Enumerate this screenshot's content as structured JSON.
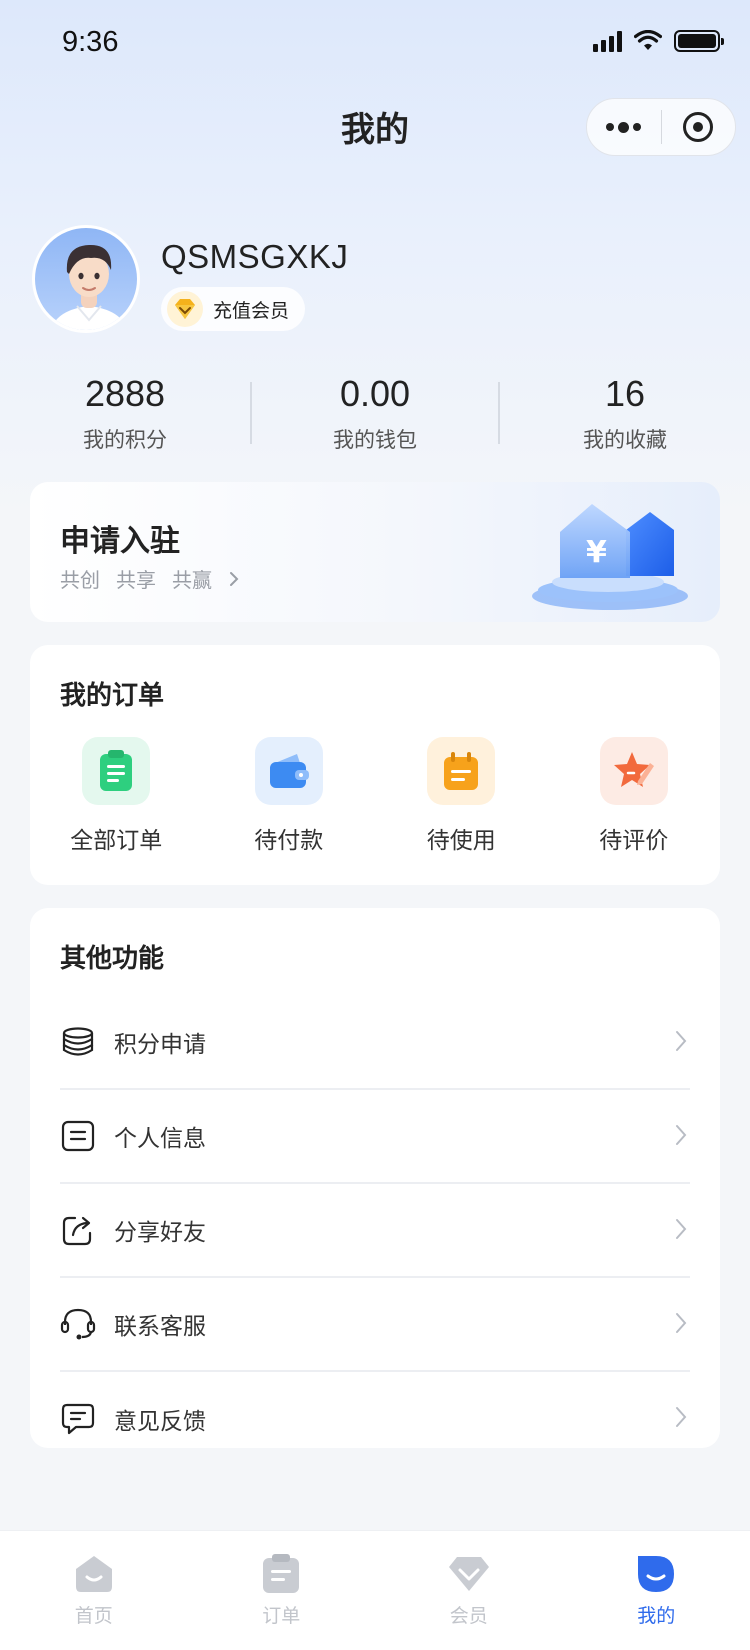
{
  "status_bar": {
    "time": "9:36"
  },
  "nav": {
    "title": "我的"
  },
  "profile": {
    "username": "QSMSGXKJ",
    "member_label": "充值会员"
  },
  "stats": [
    {
      "value": "2888",
      "label": "我的积分"
    },
    {
      "value": "0.00",
      "label": "我的钱包"
    },
    {
      "value": "16",
      "label": "我的收藏"
    }
  ],
  "apply": {
    "title": "申请入驻",
    "tags": [
      "共创",
      "共享",
      "共赢"
    ]
  },
  "orders": {
    "title": "我的订单",
    "items": [
      {
        "label": "全部订单",
        "icon": "clipboard-icon",
        "color": "#2ecf7f"
      },
      {
        "label": "待付款",
        "icon": "wallet-icon",
        "color": "#3d8bf2"
      },
      {
        "label": "待使用",
        "icon": "calendar-icon",
        "color": "#f7a21b"
      },
      {
        "label": "待评价",
        "icon": "star-pen-icon",
        "color": "#f26a3d"
      }
    ]
  },
  "functions": {
    "title": "其他功能",
    "items": [
      {
        "label": "积分申请",
        "icon": "coins-stack-icon"
      },
      {
        "label": "个人信息",
        "icon": "profile-card-icon"
      },
      {
        "label": "分享好友",
        "icon": "share-icon"
      },
      {
        "label": "联系客服",
        "icon": "headset-icon"
      },
      {
        "label": "意见反馈",
        "icon": "feedback-icon"
      }
    ]
  },
  "tabbar": {
    "items": [
      {
        "label": "首页",
        "icon": "home-icon",
        "active": false
      },
      {
        "label": "订单",
        "icon": "order-icon",
        "active": false
      },
      {
        "label": "会员",
        "icon": "member-icon",
        "active": false
      },
      {
        "label": "我的",
        "icon": "profile-icon",
        "active": true
      }
    ],
    "active_color": "#2f6bec",
    "inactive_color": "#c2c5cb"
  }
}
